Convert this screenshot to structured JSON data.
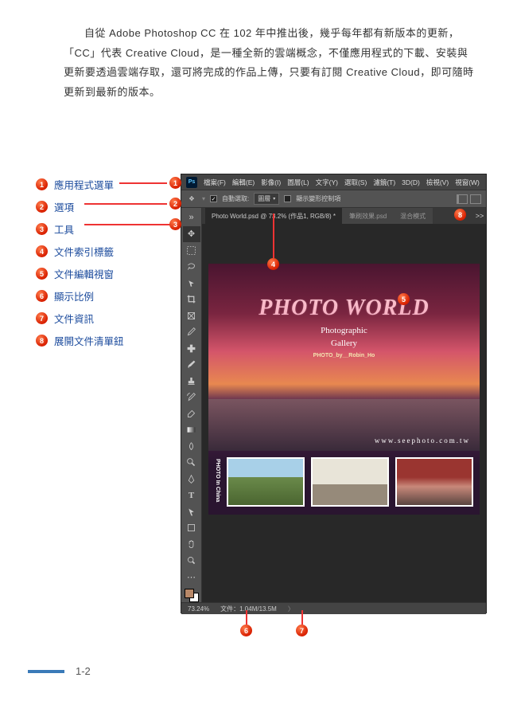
{
  "intro": "自從 Adobe Photoshop CC 在 102 年中推出後，幾乎每年都有新版本的更新，「CC」代表 Creative Cloud，是一種全新的雲端概念，不僅應用程式的下載、安裝與更新要透過雲端存取，還可將完成的作品上傳，只要有訂閱 Creative Cloud，即可隨時更新到最新的版本。",
  "legend": [
    {
      "n": "1",
      "label": "應用程式選單"
    },
    {
      "n": "2",
      "label": "選項"
    },
    {
      "n": "3",
      "label": "工具"
    },
    {
      "n": "4",
      "label": "文件索引標籤"
    },
    {
      "n": "5",
      "label": "文件編輯視窗"
    },
    {
      "n": "6",
      "label": "顯示比例"
    },
    {
      "n": "7",
      "label": "文件資訊"
    },
    {
      "n": "8",
      "label": "展開文件清單鈕"
    }
  ],
  "ps": {
    "logo": "Ps",
    "menus": [
      "檔案(F)",
      "編輯(E)",
      "影像(I)",
      "圖層(L)",
      "文字(Y)",
      "選取(S)",
      "濾鏡(T)",
      "3D(D)",
      "檢視(V)",
      "視窗(W)"
    ],
    "options": {
      "auto_select_label": "自動選取:",
      "auto_select_value": "圖層",
      "show_transform_label": "顯示變形控制項"
    },
    "tabs": [
      {
        "label": "Photo World.psd @ 73.2% (作品1, RGB/8) *",
        "active": true
      },
      {
        "label": "筆刷效果.psd",
        "active": false
      },
      {
        "label": "混合模式",
        "active": false
      }
    ],
    "tab_expand": ">>",
    "artboard": {
      "title": "PHOTO WORLD",
      "sub1": "Photographic",
      "sub2": "Gallery",
      "credit": "PHOTO_by__Robin_Ho",
      "url": "www.seephoto.com.tw",
      "vtext": "PHOTO In China"
    },
    "status": {
      "zoom": "73.24%",
      "info": "文件：1.04M/13.5M",
      "chev": "〉"
    }
  },
  "callouts": {
    "c1": "1",
    "c2": "2",
    "c3": "3",
    "c4": "4",
    "c5": "5",
    "c6": "6",
    "c7": "7",
    "c8": "8"
  },
  "page_number": "1-2"
}
